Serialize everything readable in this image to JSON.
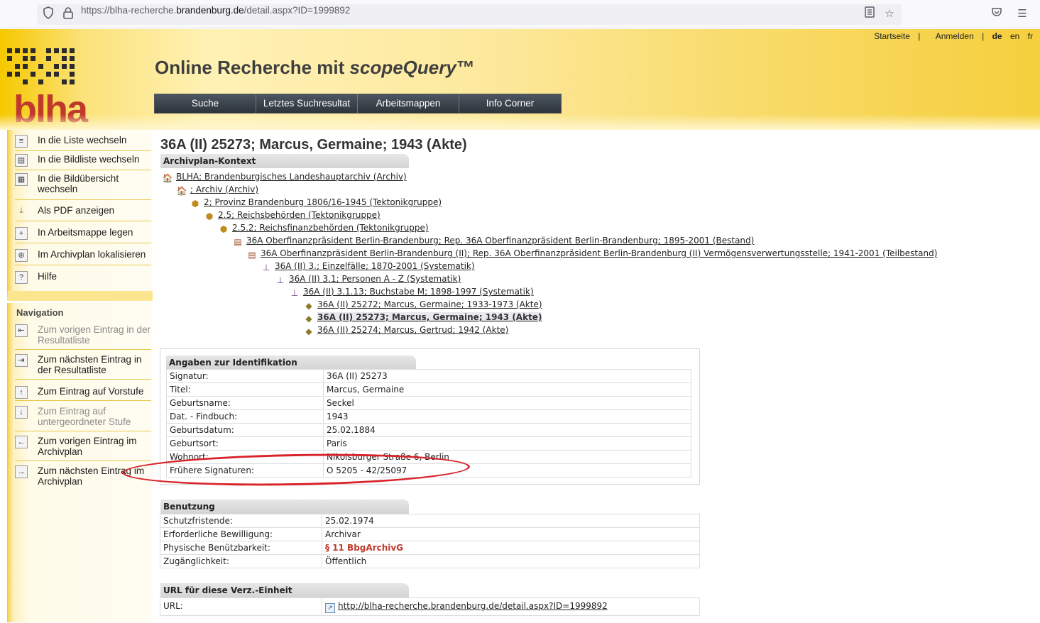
{
  "browser": {
    "url_prefix": "https://blha-recherche.",
    "url_host": "brandenburg.de",
    "url_path": "/detail.aspx?ID=1999892",
    "icons": [
      "shield-icon",
      "lock-icon",
      "reader-view-icon",
      "bookmark-star-icon",
      "pocket-icon",
      "hamburger-menu-icon"
    ]
  },
  "header": {
    "logo_text": "blha",
    "title_plain": "Online Recherche mit ",
    "title_italic": "scopeQuery",
    "title_tm": "™",
    "topnav": {
      "start": "Startseite",
      "sep1": "|",
      "login": "Anmelden",
      "sep2": "|",
      "lang_de": "de",
      "lang_en": "en",
      "lang_fr": "fr"
    },
    "menu": [
      "Suche",
      "Letztes Suchresultat",
      "Arbeitsmappen",
      "Info Corner"
    ]
  },
  "sidebar": {
    "actions": [
      {
        "icon": "list-icon",
        "label": "In die Liste wechseln"
      },
      {
        "icon": "image-list-icon",
        "label": "In die Bildliste wechseln"
      },
      {
        "icon": "grid-icon",
        "label": "In die Bildübersicht wechseln"
      },
      {
        "icon": "pdf-icon",
        "label": "Als PDF anzeigen"
      },
      {
        "icon": "folder-add-icon",
        "label": "In Arbeitsmappe legen"
      },
      {
        "icon": "locate-icon",
        "label": "Im Archivplan lokalisieren"
      },
      {
        "icon": "help-icon",
        "label": "Hilfe"
      }
    ],
    "nav_title": "Navigation",
    "navigation": [
      {
        "icon": "prev-result-icon",
        "label": "Zum vorigen Eintrag in der Resultatliste",
        "enabled": false
      },
      {
        "icon": "next-result-icon",
        "label": "Zum nächsten Eintrag in der Resultatliste",
        "enabled": true
      },
      {
        "icon": "arrow-up-icon",
        "label": "Zum Eintrag auf Vorstufe",
        "enabled": true
      },
      {
        "icon": "arrow-down-icon",
        "label": "Zum Eintrag auf untergeordneter Stufe",
        "enabled": false
      },
      {
        "icon": "arrow-left-icon",
        "label": "Zum vorigen Eintrag im Archivplan",
        "enabled": true
      },
      {
        "icon": "arrow-right-icon",
        "label": "Zum nächsten Eintrag im Archivplan",
        "enabled": true
      }
    ]
  },
  "main": {
    "title": "36A (II) 25273; Marcus, Germaine; 1943 (Akte)",
    "archivplan": {
      "heading": "Archivplan-Kontext",
      "items": [
        {
          "icon": "house-icon",
          "label": "BLHA; Brandenburgisches Landeshauptarchiv (Archiv)"
        },
        {
          "icon": "house-icon",
          "label": "; Archiv (Archiv)"
        },
        {
          "icon": "group-icon",
          "label": "2; Provinz Brandenburg 1806/16-1945 (Tektonikgruppe)"
        },
        {
          "icon": "group-icon",
          "label": "2.5; Reichsbehörden (Tektonikgruppe)"
        },
        {
          "icon": "group-icon",
          "label": "2.5.2; Reichsfinanzbehörden (Tektonikgruppe)"
        },
        {
          "icon": "cabinet-icon",
          "label": "36A Oberfinanzpräsident Berlin-Brandenburg; Rep. 36A Oberfinanzpräsident Berlin-Brandenburg; 1895-2001 (Bestand)"
        },
        {
          "icon": "cabinet-icon",
          "label": "36A Oberfinanzpräsident Berlin-Brandenburg (II); Rep. 36A Oberfinanzpräsident Berlin-Brandenburg (II) Vermögensverwertungsstelle; 1941-2001 (Teilbestand)"
        },
        {
          "icon": "hierarchy-icon",
          "label": "36A (II) 3.; Einzelfälle; 1870-2001 (Systematik)"
        },
        {
          "icon": "hierarchy-icon",
          "label": "36A (II) 3.1; Personen A - Z (Systematik)"
        },
        {
          "icon": "hierarchy-icon",
          "label": "36A (II) 3.1.13; Buchstabe M; 1898-1997 (Systematik)"
        },
        {
          "icon": "file-icon",
          "label": "36A (II) 25272; Marcus, Germaine; 1933-1973 (Akte)"
        },
        {
          "icon": "file-icon",
          "label": "36A (II) 25273; Marcus, Germaine; 1943 (Akte)"
        },
        {
          "icon": "file-icon",
          "label": "36A (II) 25274; Marcus, Gertrud; 1942 (Akte)"
        }
      ]
    },
    "identification": {
      "heading": "Angaben zur Identifikation",
      "rows": [
        {
          "key": "Signatur:",
          "value": "36A (II) 25273"
        },
        {
          "key": "Titel:",
          "value": "Marcus, Germaine"
        },
        {
          "key": "Geburtsname:",
          "value": "Seckel"
        },
        {
          "key": "Dat. - Findbuch:",
          "value": "1943"
        },
        {
          "key": "Geburtsdatum:",
          "value": "25.02.1884"
        },
        {
          "key": "Geburtsort:",
          "value": "Paris"
        },
        {
          "key": "Wohnort:",
          "value": "Nikolsburger Straße 6, Berlin"
        },
        {
          "key": "Frühere Signaturen:",
          "value": "O 5205 - 42/25097"
        }
      ]
    },
    "usage": {
      "heading": "Benutzung",
      "rows": [
        {
          "key": "Schutzfristende:",
          "value": "25.02.1974"
        },
        {
          "key": "Erforderliche Bewilligung:",
          "value": "Archivar"
        },
        {
          "key": "Physische Benützbarkeit:",
          "value": "§ 11 BbgArchivG"
        },
        {
          "key": "Zugänglichkeit:",
          "value": "Öffentlich"
        }
      ]
    },
    "url_section": {
      "heading": "URL für diese Verz.-Einheit",
      "key": "URL:",
      "value": "http://blha-recherche.brandenburg.de/detail.aspx?ID=1999892"
    }
  }
}
